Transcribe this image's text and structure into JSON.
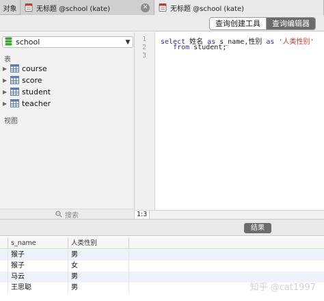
{
  "tabs": {
    "objects_label": "对象",
    "tab1_title": "无标题 @school (kate)",
    "tab2_title": "无标题 @school (kate)",
    "close_glyph": "✕"
  },
  "toolbar": {
    "query_builder": "查询创建工具",
    "query_editor": "查询编辑器"
  },
  "sidebar": {
    "database": "school",
    "tables_label": "表",
    "tables": [
      "course",
      "score",
      "student",
      "teacher"
    ],
    "views_label": "视图",
    "search_placeholder": "搜索"
  },
  "editor": {
    "line_numbers": [
      "1",
      "2",
      "3"
    ],
    "lines": {
      "l1_kw1": "select",
      "l1_text1": " 姓名 ",
      "l1_kw2": "as",
      "l1_text2": " s_name,性别 ",
      "l1_kw3": "as",
      "l1_text3": " ",
      "l1_str": "'人类性别'",
      "l2_indent": "   ",
      "l2_kw": "from",
      "l2_text": " student;"
    },
    "cursor_position": "1:3"
  },
  "results": {
    "button_label": "结果",
    "columns": [
      "s_name",
      "人类性别"
    ],
    "rows": [
      [
        "猴子",
        "男"
      ],
      [
        "猴子",
        "女"
      ],
      [
        "马云",
        "男"
      ],
      [
        "王思聪",
        "男"
      ]
    ]
  },
  "watermark": "知乎 @cat1997",
  "colors": {
    "active_segment": "#6b6b6b",
    "keyword": "#2a2aa0",
    "string": "#c0392b",
    "alt_row": "#eef3fb"
  }
}
